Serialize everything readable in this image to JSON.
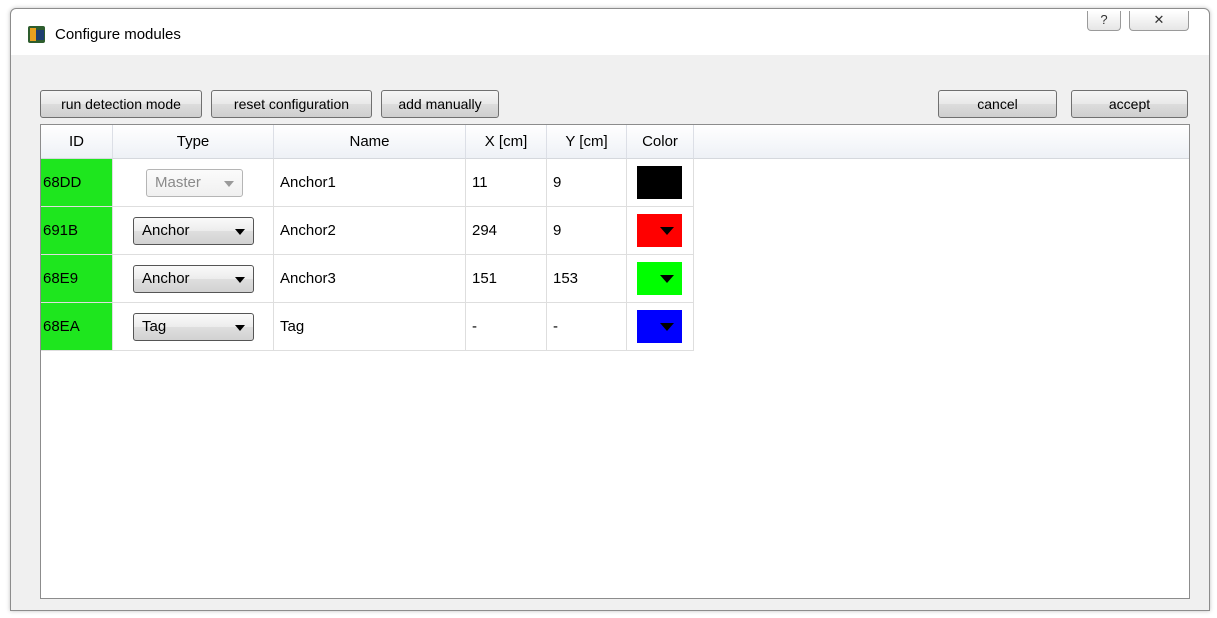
{
  "window": {
    "title": "Configure modules",
    "help_glyph": "?",
    "close_glyph": "✕"
  },
  "toolbar": {
    "run_detection": "run detection mode",
    "reset_configuration": "reset configuration",
    "add_manually": "add manually",
    "cancel": "cancel",
    "accept": "accept"
  },
  "table": {
    "headers": [
      "ID",
      "Type",
      "Name",
      "X [cm]",
      "Y [cm]",
      "Color"
    ],
    "rows": [
      {
        "id": "68DD",
        "type": "Master",
        "type_enabled": false,
        "name": "Anchor1",
        "x": "11",
        "y": "9",
        "color": "#000000",
        "color_dropdown": false
      },
      {
        "id": "691B",
        "type": "Anchor",
        "type_enabled": true,
        "name": "Anchor2",
        "x": "294",
        "y": "9",
        "color": "#ff0000",
        "color_dropdown": true
      },
      {
        "id": "68E9",
        "type": "Anchor",
        "type_enabled": true,
        "name": "Anchor3",
        "x": "151",
        "y": "153",
        "color": "#00ff00",
        "color_dropdown": true
      },
      {
        "id": "68EA",
        "type": "Tag",
        "type_enabled": true,
        "name": "Tag",
        "x": "-",
        "y": "-",
        "color": "#0000ff",
        "color_dropdown": true
      }
    ],
    "id_cell_color": "#1ee61e"
  }
}
